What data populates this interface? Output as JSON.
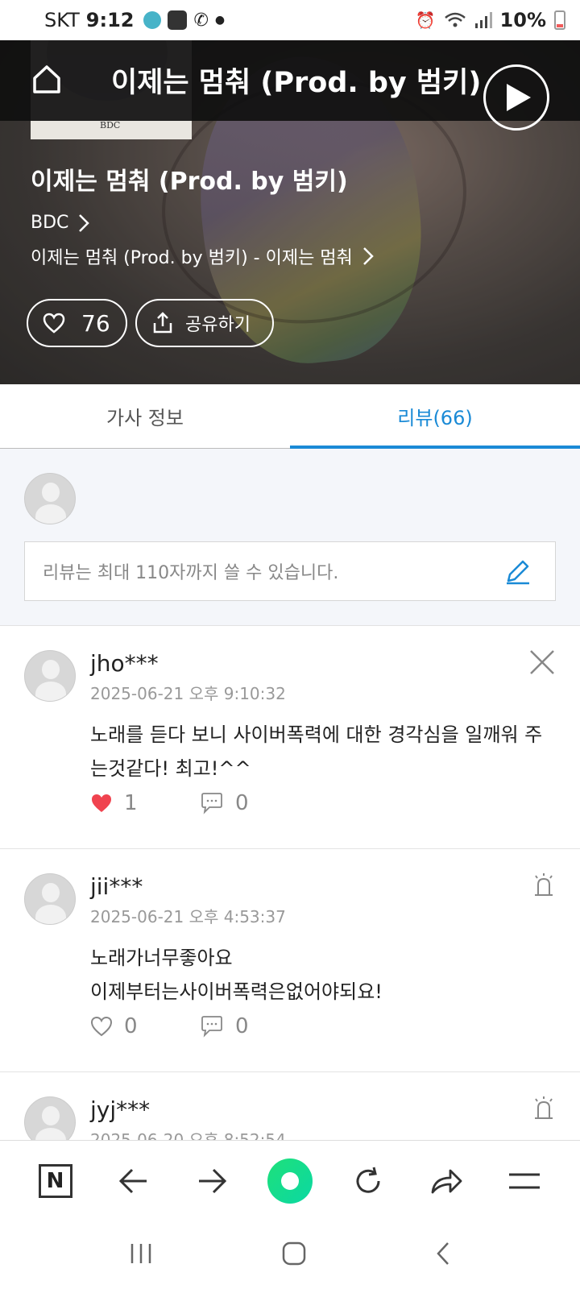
{
  "status_bar": {
    "carrier": "SKT",
    "time": "9:12",
    "battery": "10%"
  },
  "header": {
    "title": "이제는 멈춰 (Prod. by 범키)",
    "album_thumb_text": "BDC"
  },
  "song": {
    "title": "이제는 멈춰 (Prod. by 범키)",
    "artist": "BDC",
    "album": "이제는 멈춰 (Prod. by 범키) - 이제는 멈춰",
    "like_count": "76",
    "share_label": "공유하기"
  },
  "tabs": [
    {
      "label": "가사 정보",
      "active": false
    },
    {
      "label": "리뷰(66)",
      "active": true
    }
  ],
  "review_input": {
    "placeholder": "리뷰는 최대 110자까지 쓸 수 있습니다."
  },
  "reviews": [
    {
      "user": "jho***",
      "date": "2025-06-21 오후 9:10:32",
      "text": "노래를 듣다 보니 사이버폭력에 대한 경각심을 일깨워 주는것같다! 최고!^^",
      "likes": "1",
      "comments": "0",
      "liked": true,
      "corner_icon": "close-icon"
    },
    {
      "user": "jii***",
      "date": "2025-06-21 오후 4:53:37",
      "text": "노래가너무좋아요\n이제부터는사이버폭력은없어야되요!",
      "likes": "0",
      "comments": "0",
      "liked": false,
      "corner_icon": "report-siren-icon"
    },
    {
      "user": "jyj***",
      "date": "2025-06-20 오후 8:52:54",
      "corner_icon": "report-siren-icon"
    }
  ],
  "colors": {
    "accent": "#1a8ad6",
    "heart_liked": "#f0434f",
    "naver_green": "#03c75a"
  }
}
